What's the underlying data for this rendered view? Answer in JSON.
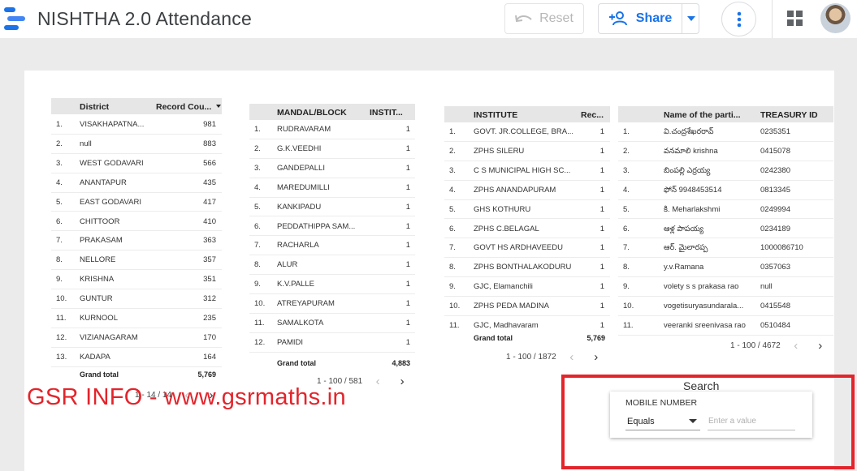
{
  "header": {
    "title": "NISHTHA 2.0 Attendance",
    "reset_label": "Reset",
    "share_label": "Share"
  },
  "tables": {
    "district": {
      "columns": [
        "District",
        "Record Cou..."
      ],
      "rows": [
        [
          "1.",
          "VISAKHAPATNA...",
          "981"
        ],
        [
          "2.",
          "null",
          "883"
        ],
        [
          "3.",
          "WEST GODAVARI",
          "566"
        ],
        [
          "4.",
          "ANANTAPUR",
          "435"
        ],
        [
          "5.",
          "EAST GODAVARI",
          "417"
        ],
        [
          "6.",
          "CHITTOOR",
          "410"
        ],
        [
          "7.",
          "PRAKASAM",
          "363"
        ],
        [
          "8.",
          "NELLORE",
          "357"
        ],
        [
          "9.",
          "KRISHNA",
          "351"
        ],
        [
          "10.",
          "GUNTUR",
          "312"
        ],
        [
          "11.",
          "KURNOOL",
          "235"
        ],
        [
          "12.",
          "VIZIANAGARAM",
          "170"
        ],
        [
          "13.",
          "KADAPA",
          "164"
        ]
      ],
      "grand_total_label": "Grand total",
      "grand_total": "5,769",
      "pager": "1 - 14 / 14"
    },
    "mandal": {
      "columns": [
        "MANDAL/BLOCK",
        "INSTIT..."
      ],
      "rows": [
        [
          "1.",
          "RUDRAVARAM",
          "1"
        ],
        [
          "2.",
          "G.K.VEEDHI",
          "1"
        ],
        [
          "3.",
          "GANDEPALLI",
          "1"
        ],
        [
          "4.",
          "MAREDUMILLI",
          "1"
        ],
        [
          "5.",
          "KANKIPADU",
          "1"
        ],
        [
          "6.",
          "PEDDATHIPPA SAM...",
          "1"
        ],
        [
          "7.",
          "RACHARLA",
          "1"
        ],
        [
          "8.",
          "ALUR",
          "1"
        ],
        [
          "9.",
          "K.V.PALLE",
          "1"
        ],
        [
          "10.",
          "ATREYAPURAM",
          "1"
        ],
        [
          "11.",
          "SAMALKOTA",
          "1"
        ],
        [
          "12.",
          "PAMIDI",
          "1"
        ]
      ],
      "grand_total_label": "Grand total",
      "grand_total": "4,883",
      "pager": "1 - 100 / 581"
    },
    "institute": {
      "columns": [
        "INSTITUTE",
        "Rec..."
      ],
      "rows": [
        [
          "1.",
          "GOVT. JR.COLLEGE, BRA...",
          "1"
        ],
        [
          "2.",
          "ZPHS SILERU",
          "1"
        ],
        [
          "3.",
          "C S MUNICIPAL HIGH SC...",
          "1"
        ],
        [
          "4.",
          "ZPHS ANANDAPURAM",
          "1"
        ],
        [
          "5.",
          "GHS KOTHURU",
          "1"
        ],
        [
          "6.",
          "ZPHS C.BELAGAL",
          "1"
        ],
        [
          "7.",
          "GOVT HS ARDHAVEEDU",
          "1"
        ],
        [
          "8.",
          "ZPHS BONTHALAKODURU",
          "1"
        ],
        [
          "9.",
          "GJC, Elamanchili",
          "1"
        ],
        [
          "10.",
          "ZPHS PEDA MADINA",
          "1"
        ],
        [
          "11.",
          "GJC, Madhavaram",
          "1"
        ]
      ],
      "grand_total_label": "Grand total",
      "grand_total": "5,769",
      "pager": "1 - 100 / 1872"
    },
    "participant": {
      "columns": [
        "Name of the parti...",
        "TREASURY ID"
      ],
      "rows": [
        [
          "1.",
          "వి.చంద్రశేఖరరావ్",
          "0235351"
        ],
        [
          "2.",
          "వనమాలి krishna",
          "0415078"
        ],
        [
          "3.",
          "బింపల్లి ఎర్రయ్య",
          "0242380"
        ],
        [
          "4.",
          "ఫోన్ 9948453514",
          "0813345"
        ],
        [
          "5.",
          "కి. Meharlakshmi",
          "0249994"
        ],
        [
          "6.",
          "ఆళ్ల పాపయ్య",
          "0234189"
        ],
        [
          "7.",
          "ఆర్. మైలారప్ప",
          "1000086710"
        ],
        [
          "8.",
          "y.v.Ramana",
          "0357063"
        ],
        [
          "9.",
          "volety s s prakasa rao",
          "null"
        ],
        [
          "10.",
          "vogetisuryasundarala...",
          "0415548"
        ],
        [
          "11.",
          "veeranki sreenivasa rao",
          "0510484"
        ]
      ],
      "pager": "1 - 100 / 4672"
    }
  },
  "watermark": "GSR INFO - www.gsrmaths.in",
  "search": {
    "title": "Search",
    "field_label": "MOBILE NUMBER",
    "operator": "Equals",
    "placeholder": "Enter a value"
  },
  "colors": {
    "accent": "#1a73e8",
    "highlight": "#e3242b",
    "header_row": "#e6e6e6"
  }
}
